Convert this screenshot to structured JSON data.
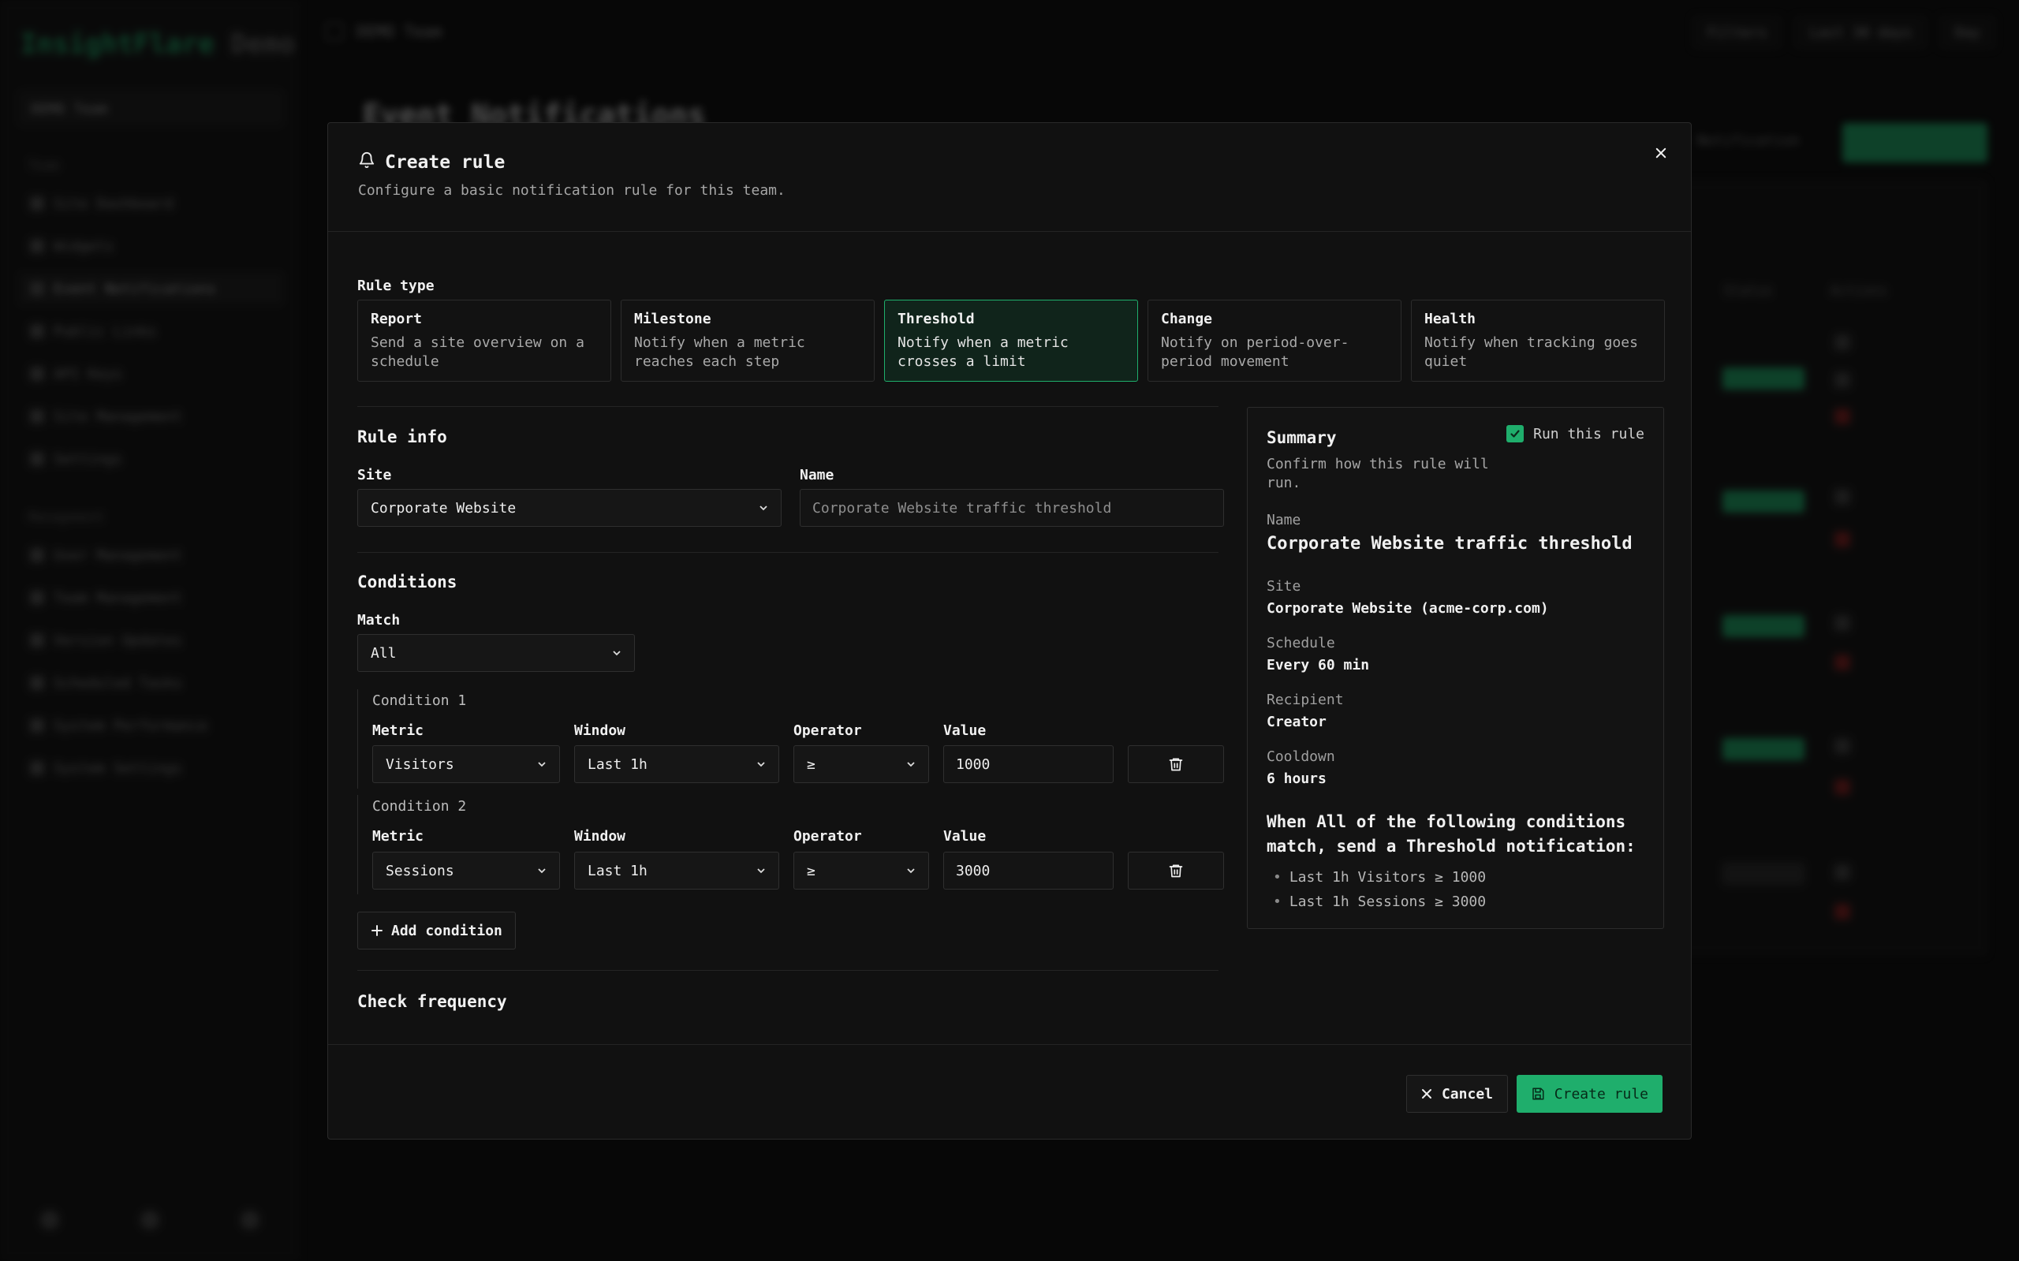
{
  "background": {
    "brand": {
      "name": "InsightFlare",
      "suffix": "Demo"
    },
    "team_select": "DEMO Team",
    "nav_section_team": "Team",
    "nav_team": [
      "Site Dashboard",
      "Widgets",
      "Event Notifications",
      "Public Links",
      "API Keys",
      "Site Management",
      "Settings"
    ],
    "nav_section_mgmt": "Management",
    "nav_mgmt": [
      "User Management",
      "Team Management",
      "Version Updates",
      "Scheduled Tasks",
      "System Performance",
      "System Settings"
    ],
    "topbar_title": "DEMO Team",
    "topbar_filters": "Filters",
    "topbar_range": "Last 30 days",
    "topbar_lang": "Day",
    "page_title": "Event Notifications",
    "header_link": "Notification",
    "table_headers": {
      "status": "Status",
      "actions": "Actions"
    },
    "disabled_label": "Disabled"
  },
  "modal": {
    "title": "Create rule",
    "subtitle": "Configure a basic notification rule for this team.",
    "rule_type_label": "Rule type",
    "rule_types": [
      {
        "name": "Report",
        "desc": "Send a site overview on a schedule"
      },
      {
        "name": "Milestone",
        "desc": "Notify when a metric reaches each step"
      },
      {
        "name": "Threshold",
        "desc": "Notify when a metric crosses a limit"
      },
      {
        "name": "Change",
        "desc": "Notify on period-over-period movement"
      },
      {
        "name": "Health",
        "desc": "Notify when tracking goes quiet"
      }
    ],
    "selected_rule_type": "Threshold",
    "rule_info": {
      "heading": "Rule info",
      "site_label": "Site",
      "site_value": "Corporate Website",
      "name_label": "Name",
      "name_placeholder": "Corporate Website traffic threshold"
    },
    "conditions": {
      "heading": "Conditions",
      "match_label": "Match",
      "match_value": "All",
      "labels": {
        "metric": "Metric",
        "window": "Window",
        "operator": "Operator",
        "value": "Value"
      },
      "items": [
        {
          "title": "Condition 1",
          "metric": "Visitors",
          "window": "Last 1h",
          "operator": "≥",
          "value": "1000"
        },
        {
          "title": "Condition 2",
          "metric": "Sessions",
          "window": "Last 1h",
          "operator": "≥",
          "value": "3000"
        }
      ],
      "add_label": "Add condition"
    },
    "check_frequency_heading": "Check frequency",
    "summary": {
      "title": "Summary",
      "subtitle": "Confirm how this rule will run.",
      "run_label": "Run this rule",
      "run_checked": true,
      "name_k": "Name",
      "name_v": "Corporate Website traffic threshold",
      "site_k": "Site",
      "site_v": "Corporate Website (acme-corp.com)",
      "schedule_k": "Schedule",
      "schedule_v": "Every 60 min",
      "recipient_k": "Recipient",
      "recipient_v": "Creator",
      "cooldown_k": "Cooldown",
      "cooldown_v": "6 hours",
      "when_text": "When All of the following conditions match, send a Threshold notification:",
      "bullets": [
        "Last 1h Visitors ≥ 1000",
        "Last 1h Sessions ≥ 3000"
      ]
    },
    "cancel_label": "Cancel",
    "create_label": "Create rule"
  },
  "colors": {
    "accent": "#1fae6c",
    "background": "#0b0b0b",
    "modal": "#111111"
  }
}
